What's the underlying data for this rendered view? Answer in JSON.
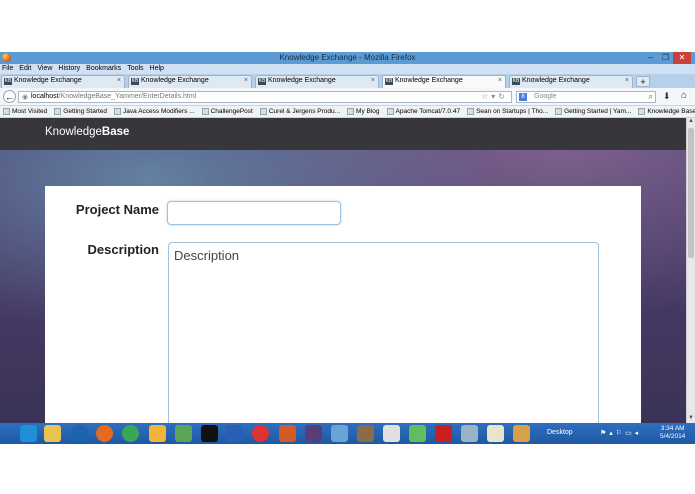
{
  "window": {
    "title": "Knowledge Exchange - Mozilla Firefox"
  },
  "menu": [
    "File",
    "Edit",
    "View",
    "History",
    "Bookmarks",
    "Tools",
    "Help"
  ],
  "tabs": [
    {
      "label": "Knowledge Exchange",
      "close": "×",
      "active": false
    },
    {
      "label": "Knowledge Exchange",
      "close": "×",
      "active": false
    },
    {
      "label": "Knowledge Exchange",
      "close": "×",
      "active": false
    },
    {
      "label": "Knowledge Exchange",
      "close": "×",
      "active": true
    },
    {
      "label": "Knowledge Exchange",
      "close": "×",
      "active": false
    }
  ],
  "tab_favicon": "KB",
  "navbar": {
    "url_host": "localhost",
    "url_path": "/KnowledgeBase_Yammer/EnterDetails.html",
    "search_engine": "8",
    "search_placeholder": "Google"
  },
  "bookmarks": [
    "Most Visited",
    "Getting Started",
    "Java Access Modifiers ...",
    "ChallengePost",
    "Curel & Jergens Produ...",
    "My Blog",
    "Apache Tomcat/7.0.47",
    "Sean on Startups | Tho...",
    "Getting Started | Yam...",
    "Knowledge Base Yam..."
  ],
  "site": {
    "brand_regular": "Knowledge",
    "brand_bold": "Base"
  },
  "form": {
    "project_name_label": "Project Name",
    "project_name_value": "",
    "description_label": "Description",
    "description_placeholder": "Description"
  },
  "taskbar": {
    "desktop_label": "Desktop",
    "clock_time": "3:34 AM",
    "clock_date": "5/4/2014",
    "icons": [
      "ie-icon",
      "file-explorer-icon",
      "hp-icon",
      "firefox-icon",
      "chrome-icon",
      "paint-icon",
      "evernote-icon",
      "terminal-icon",
      "word-icon",
      "media-icon",
      "powerpoint-icon",
      "eclipse-icon",
      "network-icon",
      "winrar-icon",
      "7zip-icon",
      "notepad-icon",
      "acrobat-icon",
      "vpn-icon",
      "java-icon",
      "photo-icon"
    ]
  }
}
